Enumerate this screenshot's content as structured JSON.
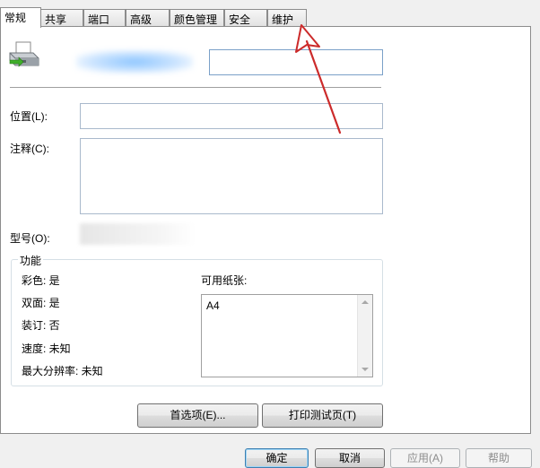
{
  "tabs": [
    {
      "label": "常规",
      "active": true
    },
    {
      "label": "共享"
    },
    {
      "label": "端口"
    },
    {
      "label": "高级"
    },
    {
      "label": "颜色管理"
    },
    {
      "label": "安全"
    },
    {
      "label": "维护"
    }
  ],
  "general": {
    "location_label": "位置(L):",
    "comment_label": "注释(C):",
    "model_label": "型号(O):",
    "location_value": "",
    "comment_value": ""
  },
  "features": {
    "legend": "功能",
    "color": "彩色: 是",
    "duplex": "双面: 是",
    "staple": "装订: 否",
    "speed": "速度: 未知",
    "max_resolution": "最大分辨率: 未知",
    "paper_label": "可用纸张:",
    "paper_items": [
      "A4"
    ]
  },
  "buttons": {
    "preferences": "首选项(E)...",
    "print_test_page": "打印测试页(T)",
    "ok": "确定",
    "cancel": "取消",
    "apply": "应用(A)",
    "help": "帮助"
  },
  "icons": {
    "printer": "printer-icon",
    "annotation_arrow": "red-arrow-icon"
  },
  "colors": {
    "accent": "#3c7fb1",
    "annotation": "#cc2b2b"
  }
}
